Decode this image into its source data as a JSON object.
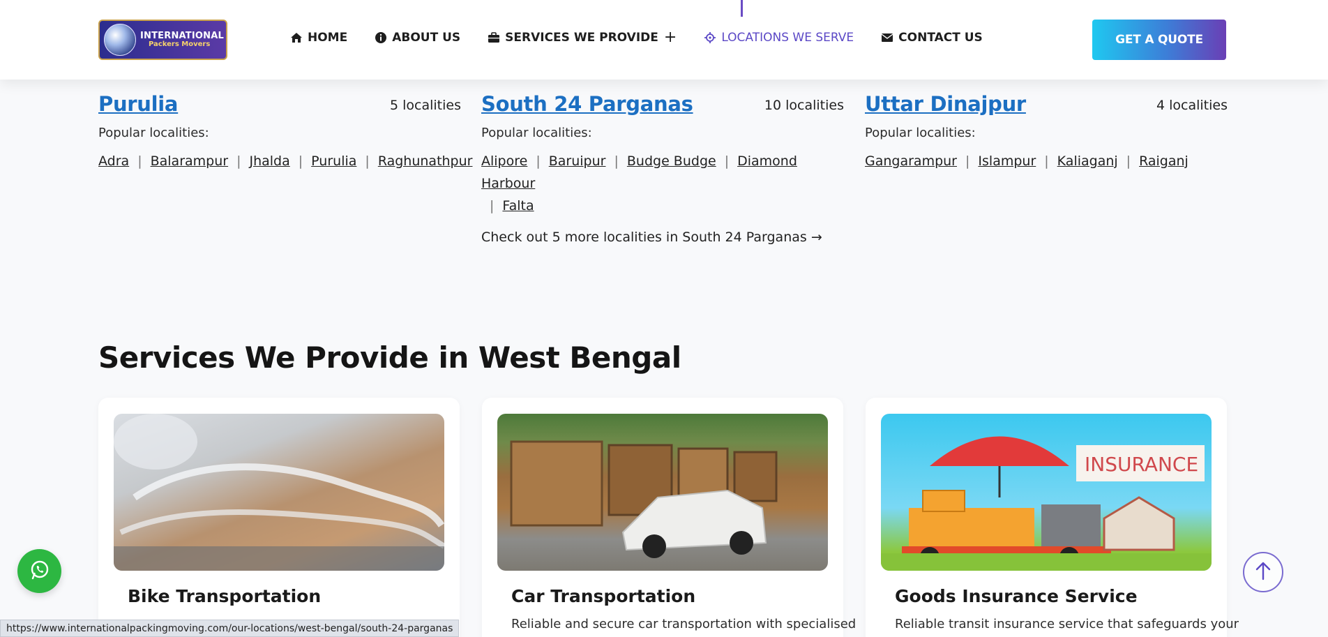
{
  "header": {
    "logo_line1": "INTERNATIONAL",
    "logo_line2": "Packers Movers",
    "nav": [
      {
        "label": "HOME",
        "icon": "home-icon"
      },
      {
        "label": "ABOUT US",
        "icon": "info-icon"
      },
      {
        "label": "SERVICES WE PROVIDE",
        "icon": "briefcase-icon"
      },
      {
        "label": "LOCATIONS WE SERVE",
        "icon": "location-target-icon"
      },
      {
        "label": "CONTACT US",
        "icon": "envelope-icon"
      }
    ],
    "quote_button": "GET A QUOTE"
  },
  "districts": [
    {
      "name": "Purulia",
      "count": "5 localities",
      "popular_label": "Popular localities:",
      "localities": [
        "Adra",
        "Balarampur",
        "Jhalda",
        "Purulia",
        "Raghunathpur"
      ]
    },
    {
      "name": "South 24 Parganas",
      "count": "10 localities",
      "popular_label": "Popular localities:",
      "localities": [
        "Alipore",
        "Baruipur",
        "Budge Budge",
        "Diamond Harbour",
        "Falta"
      ],
      "more_link": "Check out 5 more localities in South 24 Parganas →"
    },
    {
      "name": "Uttar Dinajpur",
      "count": "4 localities",
      "popular_label": "Popular localities:",
      "localities": [
        "Gangarampur",
        "Islampur",
        "Kaliaganj",
        "Raiganj"
      ]
    }
  ],
  "services": {
    "title": "Services We Provide in West Bengal",
    "cards": [
      {
        "title": "Bike Transportation",
        "desc": ""
      },
      {
        "title": "Car Transportation",
        "desc": "Reliable and secure car transportation with specialised"
      },
      {
        "title": "Goods Insurance Service",
        "desc": "Reliable transit insurance service that safeguards your",
        "image_label": "INSURANCE"
      }
    ]
  },
  "status_url": "https://www.internationalpackingmoving.com/our-locations/west-bengal/south-24-parganas",
  "colors": {
    "link_blue": "#1c6fc2",
    "nav_active": "#5b48c6",
    "whatsapp_green": "#2db742"
  }
}
